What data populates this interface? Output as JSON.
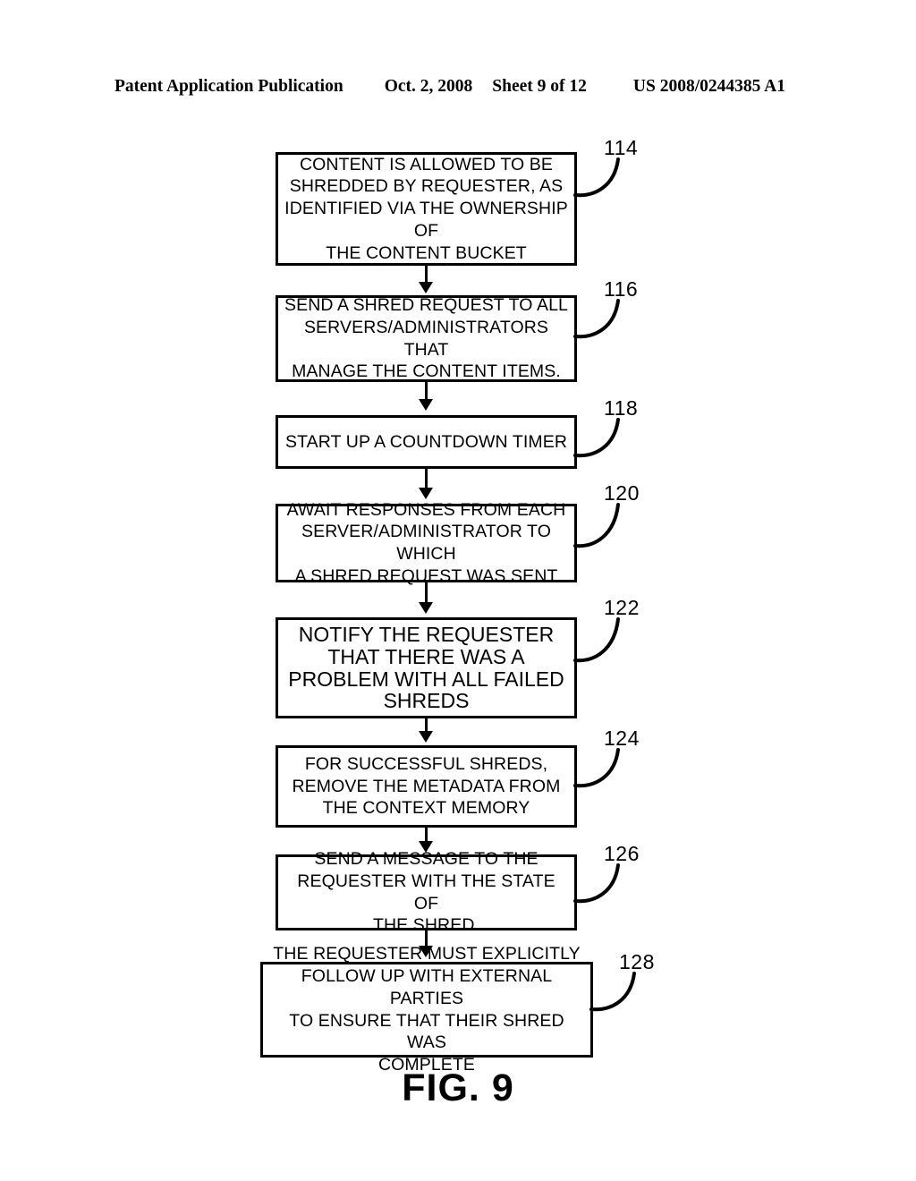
{
  "header": {
    "publication": "Patent Application Publication",
    "date": "Oct. 2, 2008",
    "sheet": "Sheet 9 of 12",
    "document_number": "US 2008/0244385 A1"
  },
  "figure": {
    "caption": "FIG. 9",
    "line_color": "#000000",
    "background_color": "#ffffff"
  },
  "flowchart": {
    "type": "flowchart",
    "orientation": "vertical",
    "nodes": [
      {
        "ref": "114",
        "text": "CONTENT IS ALLOWED TO BE\nSHREDDED BY  REQUESTER, AS\nIDENTIFIED VIA THE OWNERSHIP OF\nTHE   CONTENT BUCKET"
      },
      {
        "ref": "116",
        "text": "SEND A SHRED REQUEST TO ALL\nSERVERS/ADMINISTRATORS THAT\nMANAGE THE CONTENT ITEMS."
      },
      {
        "ref": "118",
        "text": "START UP A COUNTDOWN TIMER"
      },
      {
        "ref": "120",
        "text": "AWAIT RESPONSES FROM EACH\nSERVER/ADMINISTRATOR TO WHICH\nA SHRED REQUEST WAS SENT"
      },
      {
        "ref": "122",
        "text": "NOTIFY THE REQUESTER\nTHAT THERE WAS A\nPROBLEM WITH ALL FAILED\nSHREDS"
      },
      {
        "ref": "124",
        "text": "FOR SUCCESSFUL SHREDS,\nREMOVE THE METADATA FROM\nTHE CONTEXT MEMORY"
      },
      {
        "ref": "126",
        "text": "SEND A MESSAGE TO THE\nREQUESTER  WITH THE STATE OF\nTHE SHRED."
      },
      {
        "ref": "128",
        "text": "THE REQUESTER MUST EXPLICITLY\nFOLLOW UP WITH EXTERNAL PARTIES\nTO ENSURE THAT THEIR SHRED WAS\nCOMPLETE"
      }
    ],
    "edges": [
      {
        "from": "114",
        "to": "116"
      },
      {
        "from": "116",
        "to": "118"
      },
      {
        "from": "118",
        "to": "120"
      },
      {
        "from": "120",
        "to": "122"
      },
      {
        "from": "122",
        "to": "124"
      },
      {
        "from": "124",
        "to": "126"
      },
      {
        "from": "126",
        "to": "128"
      }
    ]
  }
}
